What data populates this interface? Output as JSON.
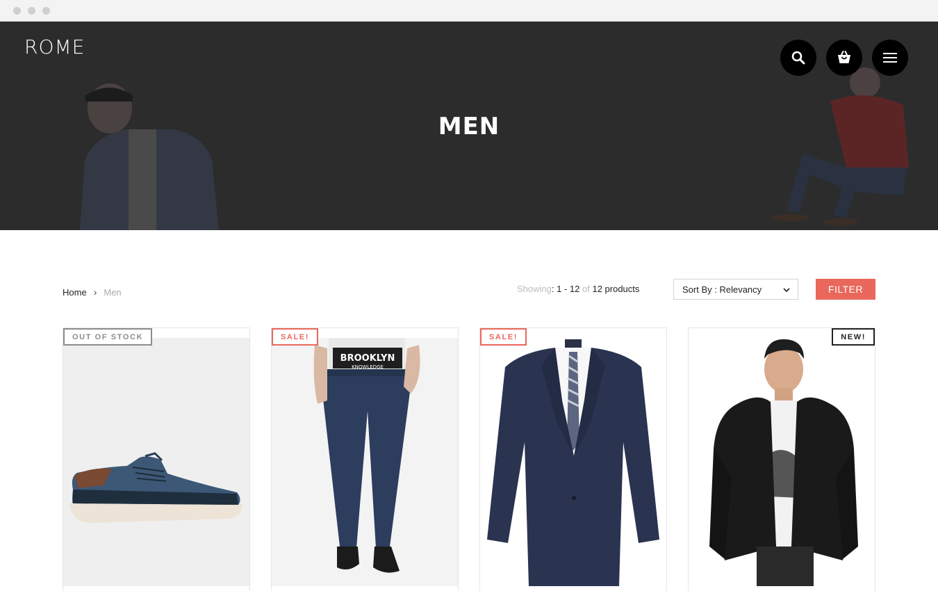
{
  "browser": {
    "dots": 3
  },
  "header": {
    "logo": "ROME",
    "title": "MEN",
    "icons": [
      "search-icon",
      "cart-icon",
      "menu-icon"
    ]
  },
  "breadcrumb": {
    "home": "Home",
    "separator": "›",
    "current": "Men"
  },
  "results": {
    "prefix": "Showing",
    "colon": ":",
    "range": "1 - 12",
    "of": "of",
    "count": "12 products"
  },
  "sort": {
    "label": "Sort By : Relevancy"
  },
  "filter": {
    "label": "FILTER"
  },
  "colors": {
    "hero_bg": "#2c2c2c",
    "accent": "#e9675b",
    "out_of_stock": "#8c8c8c",
    "new": "#222222"
  },
  "products": [
    {
      "badge": "OUT OF STOCK",
      "badge_color": "#8c8c8c",
      "item": "blue canvas sneaker"
    },
    {
      "badge": "SALE!",
      "badge_color": "#e9675b",
      "item": "dark blue jeans"
    },
    {
      "badge": "SALE!",
      "badge_color": "#e9675b",
      "item": "navy suit with tie"
    },
    {
      "badge": "NEW!",
      "badge_color": "#222222",
      "item": "black leather jacket"
    }
  ],
  "tshirt_print": {
    "line1": "BROOKLYN",
    "line2": "KNOWLEDGE"
  }
}
